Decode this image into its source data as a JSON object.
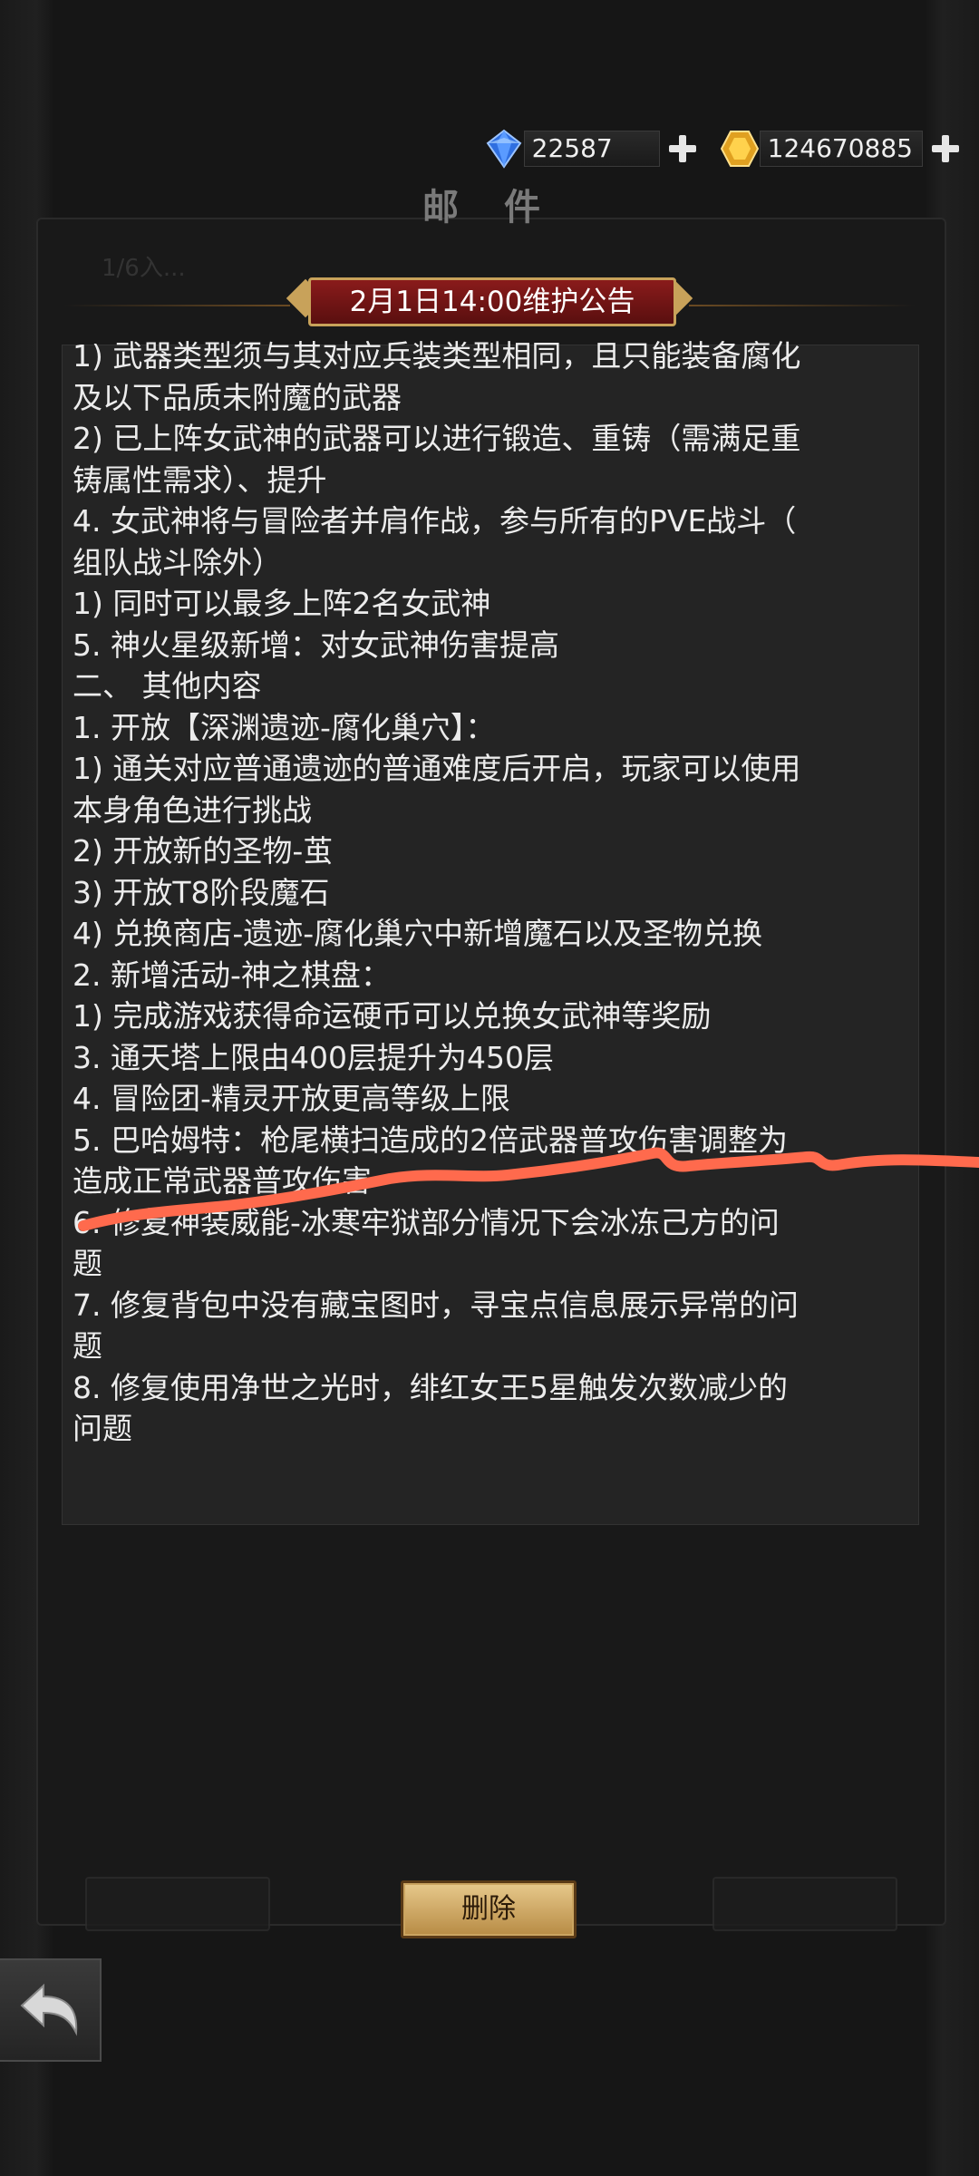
{
  "currency": {
    "diamond_value": "22587",
    "gold_value": "124670885"
  },
  "page_title": "邮 件",
  "faded_subtitle": "1/6入...",
  "mail_title": "2月1日14:00维护公告",
  "mail_lines": [
    "1) 武器类型须与其对应兵装类型相同，且只能装备腐化",
    "及以下品质未附魔的武器",
    "2) 已上阵女武神的武器可以进行锻造、重铸（需满足重",
    "铸属性需求）、提升",
    "4. 女武神将与冒险者并肩作战，参与所有的PVE战斗（",
    "组队战斗除外）",
    "1) 同时可以最多上阵2名女武神",
    "5. 神火星级新增：对女武神伤害提高",
    "二、 其他内容",
    "1. 开放【深渊遗迹-腐化巢穴】：",
    "1) 通关对应普通遗迹的普通难度后开启，玩家可以使用",
    "本身角色进行挑战",
    "2) 开放新的圣物-茧",
    "3) 开放T8阶段魔石",
    "4) 兑换商店-遗迹-腐化巢穴中新增魔石以及圣物兑换",
    "2. 新增活动-神之棋盘：",
    "1) 完成游戏获得命运硬币可以兑换女武神等奖励",
    "3. 通天塔上限由400层提升为450层",
    "4. 冒险团-精灵开放更高等级上限",
    "5. 巴哈姆特：枪尾横扫造成的2倍武器普攻伤害调整为",
    "造成正常武器普攻伤害",
    "6. 修复神装威能-冰寒牢狱部分情况下会冰冻己方的问",
    "题",
    "7. 修复背包中没有藏宝图时，寻宝点信息展示异常的问",
    "题",
    "8. 修复使用净世之光时，绯红女王5星触发次数减少的",
    "问题"
  ],
  "delete_button": "删除",
  "colors": {
    "accent_red": "#8a1b1b",
    "gold_border": "#c8a25a",
    "scribble": "#ff6a4d"
  },
  "icons": [
    "blue-diamond-icon",
    "gold-gem-icon",
    "plus-icon",
    "back-arrow-icon"
  ]
}
